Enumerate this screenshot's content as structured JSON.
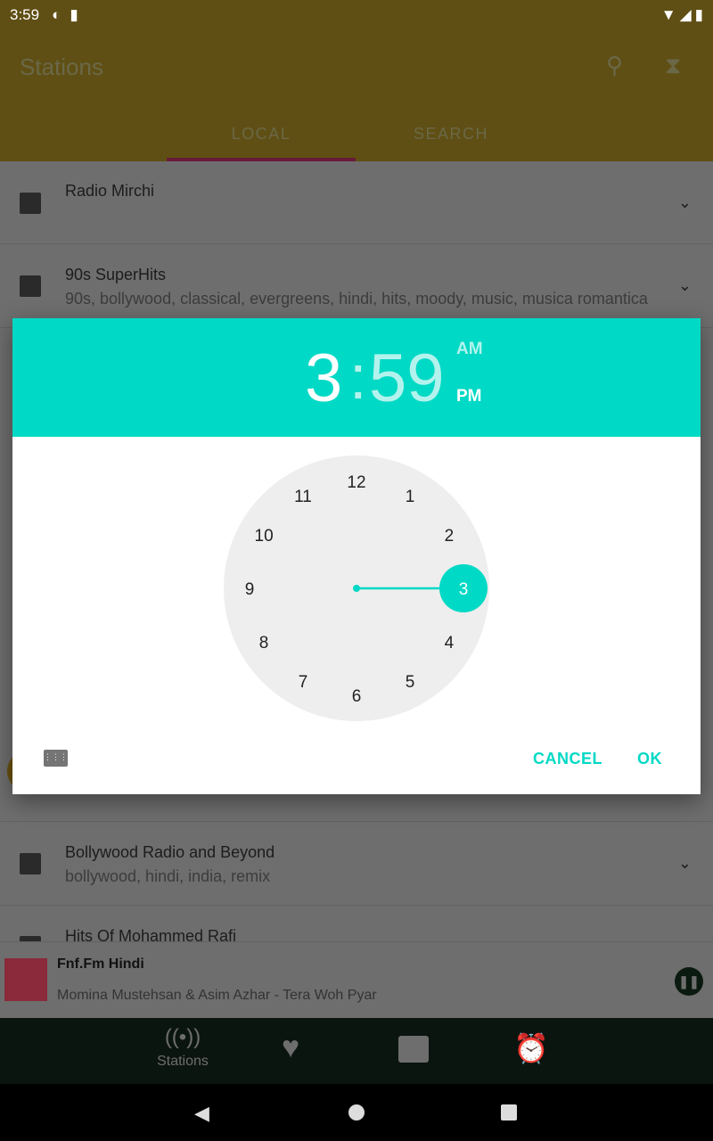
{
  "status": {
    "time": "3:59"
  },
  "appbar": {
    "title": "Stations",
    "tabs": [
      {
        "label": "LOCAL",
        "selected": true
      },
      {
        "label": "SEARCH",
        "selected": false
      }
    ]
  },
  "stations": [
    {
      "name": "Radio Mirchi",
      "tags": ""
    },
    {
      "name": "90s SuperHits",
      "tags": "90s, bollywood, classical, evergreens, hindi, hits, moody, music, musica romantica"
    },
    {
      "name": "Bollywood Radio and Beyond",
      "tags": "bollywood, hindi, india, remix"
    },
    {
      "name": "Hits Of Mohammed Rafi",
      "tags": ""
    }
  ],
  "time_picker": {
    "hour": "3",
    "separator": ":",
    "minute": "59",
    "am": "AM",
    "pm": "PM",
    "selected_period": "PM",
    "selected_hour": 3,
    "hours": [
      "12",
      "1",
      "2",
      "3",
      "4",
      "5",
      "6",
      "7",
      "8",
      "9",
      "10",
      "11"
    ],
    "cancel": "CANCEL",
    "ok": "OK"
  },
  "player": {
    "station": "Fnf.Fm Hindi",
    "track": "Momina Mustehsan & Asim Azhar - Tera Woh Pyar"
  },
  "bottom_nav": {
    "stations": "Stations"
  },
  "colors": {
    "accent": "#00d9c5",
    "appbar": "#5f4f14",
    "tab_indicator": "#6a1a3a"
  }
}
